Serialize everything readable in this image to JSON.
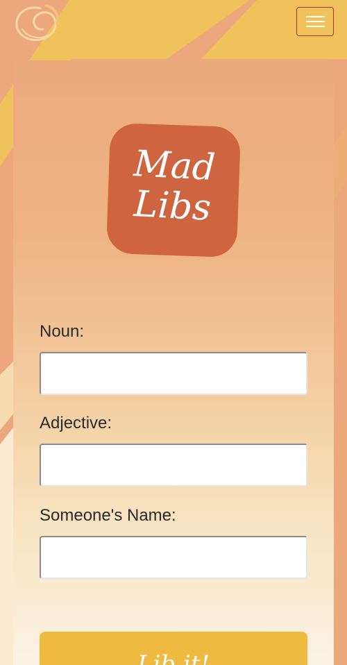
{
  "header": {
    "brand_logo_icon": "swirl-logo-icon",
    "menu_icon": "hamburger-menu-icon"
  },
  "logo": {
    "line1": "Mad",
    "line2": "Libs"
  },
  "form": {
    "fields": [
      {
        "label": "Noun:",
        "value": ""
      },
      {
        "label": "Adjective:",
        "value": ""
      },
      {
        "label": "Someone's Name:",
        "value": ""
      }
    ],
    "submit_label": "Lib it!"
  },
  "colors": {
    "background": "#eda77c",
    "stripe": "#f0c25c",
    "logo_tile": "#cf6440",
    "button": "#eeba3f",
    "menu_border": "#a8331b"
  }
}
